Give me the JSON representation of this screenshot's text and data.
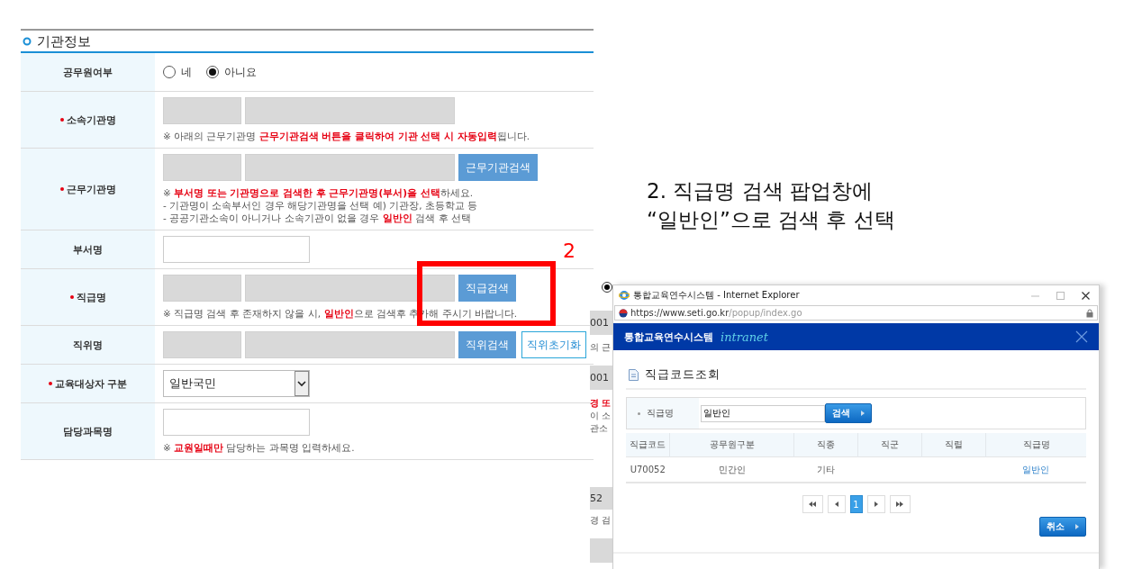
{
  "section": {
    "title": "기관정보"
  },
  "form_rows": [
    {
      "kind": "radio",
      "label": "공무원여부",
      "required": false,
      "options": [
        {
          "label": "네",
          "selected": false
        },
        {
          "label": "아니요",
          "selected": true
        }
      ]
    },
    {
      "kind": "lookup",
      "label": "소속기관명",
      "required": true,
      "fields": [
        {
          "disabled": true
        },
        {
          "disabled": true
        }
      ],
      "notes": [
        "※ 아래의 근무기관명 **근무기관검색 버튼을 클릭하여 기관 선택 시 자동입력**됩니다."
      ]
    },
    {
      "kind": "lookup",
      "label": "근무기관명",
      "required": true,
      "fields": [
        {
          "disabled": true
        },
        {
          "disabled": true
        }
      ],
      "buttons": [
        {
          "label": "근무기관검색",
          "kind": "primary"
        }
      ],
      "notes": [
        "※ **부서명 또는 기관명으로 검색한 후 근무기관명(부서)을 선택**하세요.",
        "- 기관명이 소속부서인 경우 해당기관명을 선택 예) 기관장, 초등학교 등",
        "- 공공기관소속이 아니거나 소속기관이 없을 경우 **일반인** 검색 후 선택"
      ]
    },
    {
      "kind": "lookup",
      "label": "부서명",
      "required": false,
      "fields": [
        {
          "disabled": false
        }
      ]
    },
    {
      "kind": "lookup",
      "label": "직급명",
      "required": true,
      "fields": [
        {
          "disabled": true
        },
        {
          "disabled": true
        }
      ],
      "buttons": [
        {
          "label": "직급검색",
          "kind": "primary"
        }
      ],
      "notes": [
        "※ 직급명 검색 후 존재하지 않을 시, **일반인**으로 검색후 추가해 주시기 바랍니다."
      ]
    },
    {
      "kind": "lookup",
      "label": "직위명",
      "required": false,
      "fields": [
        {
          "disabled": true
        },
        {
          "disabled": true
        }
      ],
      "buttons": [
        {
          "label": "직위검색",
          "kind": "primary"
        },
        {
          "label": "직위초기화",
          "kind": "outline"
        }
      ]
    },
    {
      "kind": "select",
      "label": "교육대상자 구분",
      "required": true,
      "value": "일반국민"
    },
    {
      "kind": "lookup",
      "label": "담당과목명",
      "required": false,
      "fields": [
        {
          "disabled": false
        }
      ],
      "notes": [
        "※ **교원일때만** 담당하는 과목명 입력하세요."
      ]
    }
  ],
  "annotation": {
    "step_number": "2",
    "lines": [
      "2. 직급명 검색 팝업창에",
      "“일반인”으로 검색 후 선택"
    ]
  },
  "background_fragments": [
    {
      "kind": "radio",
      "selected": true
    },
    {
      "kind": "field",
      "text": "001"
    },
    {
      "kind": "note",
      "text": "의 근"
    },
    {
      "kind": "field",
      "text": "001"
    },
    {
      "kind": "note_red",
      "text": "경 또"
    },
    {
      "kind": "note",
      "text": "이 소"
    },
    {
      "kind": "note",
      "text": "관소"
    },
    {
      "kind": "field",
      "text": "52"
    },
    {
      "kind": "note",
      "text": "경 검"
    },
    {
      "kind": "field"
    }
  ],
  "popup": {
    "window_title": "통합교육연수시스템 - Internet Explorer",
    "url_host": "https://www.seti.go.kr",
    "url_path": "/popup/index.go",
    "brand": "통합교육연수시스템",
    "brand_tag": "intranet",
    "page_title": "직급코드조회",
    "search": {
      "label": "직급명",
      "value": "일반인",
      "button": "검색"
    },
    "table": {
      "columns": [
        "직급코드",
        "공무원구분",
        "직종",
        "직군",
        "직렬",
        "직급명"
      ],
      "rows": [
        {
          "cells": [
            "U70052",
            "민간인",
            "기타",
            "",
            "",
            "일반인"
          ]
        }
      ]
    },
    "pagination": {
      "pages": [
        {
          "label": "1",
          "selected": true
        }
      ]
    },
    "cancel_button": "취소"
  }
}
